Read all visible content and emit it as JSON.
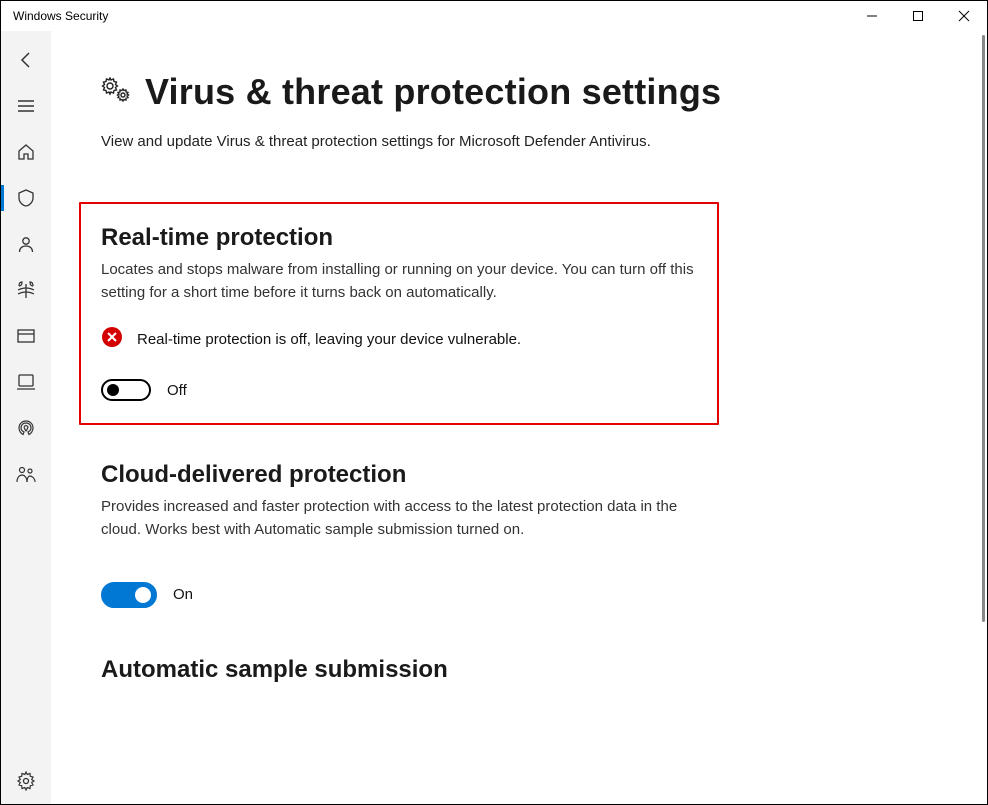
{
  "window": {
    "title": "Windows Security"
  },
  "header": {
    "title": "Virus & threat protection settings",
    "subtitle": "View and update Virus & threat protection settings for Microsoft Defender Antivirus."
  },
  "sections": {
    "realtime": {
      "title": "Real-time protection",
      "desc": "Locates and stops malware from installing or running on your device. You can turn off this setting for a short time before it turns back on automatically.",
      "warning": "Real-time protection is off, leaving your device vulnerable.",
      "toggle_state": "Off"
    },
    "cloud": {
      "title": "Cloud-delivered protection",
      "desc": "Provides increased and faster protection with access to the latest protection data in the cloud. Works best with Automatic sample submission turned on.",
      "toggle_state": "On"
    },
    "auto_submit": {
      "title": "Automatic sample submission"
    }
  }
}
